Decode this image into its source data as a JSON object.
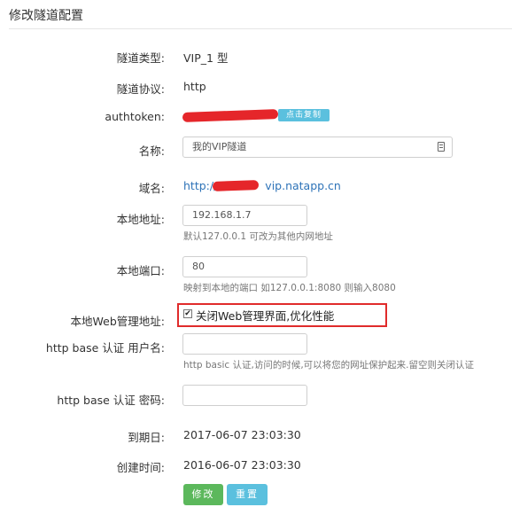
{
  "page": {
    "title": "修改隧道配置"
  },
  "fields": {
    "type_label": "隧道类型:",
    "type_value": "VIP_1 型",
    "protocol_label": "隧道协议:",
    "protocol_value": "http",
    "authtoken_label": "authtoken:",
    "copy_button": "点击复制",
    "name_label": "名称:",
    "name_value": "我的VIP隧道",
    "domain_label": "域名:",
    "domain_prefix": "http://",
    "domain_suffix": "vip.natapp.cn",
    "local_addr_label": "本地地址:",
    "local_addr_value": "192.168.1.7",
    "local_addr_hint": "默认127.0.0.1 可改为其他内网地址",
    "local_port_label": "本地端口:",
    "local_port_value": "80",
    "local_port_hint": "映射到本地的端口 如127.0.0.1:8080 则输入8080",
    "web_admin_label": "本地Web管理地址:",
    "web_admin_checkbox": "关闭Web管理界面,优化性能",
    "web_admin_checked": true,
    "auth_user_label": "http base 认证 用户名:",
    "auth_user_value": "",
    "auth_user_hint": "http basic 认证,访问的时候,可以将您的网址保护起来.留空则关闭认证",
    "auth_pass_label": "http base 认证 密码:",
    "auth_pass_value": "",
    "expire_label": "到期日:",
    "expire_value": "2017-06-07 23:03:30",
    "created_label": "创建时间:",
    "created_value": "2016-06-07 23:03:30"
  },
  "actions": {
    "submit_label": "修改",
    "reset_label": "重置"
  },
  "colors": {
    "accent_green": "#5cb85c",
    "accent_blue": "#5bc0de",
    "highlight_red": "#e02b2b",
    "link": "#2e73b8"
  },
  "icons": {
    "name_field_icon": "edit-icon",
    "checkbox_icon": "checkmark-icon"
  }
}
